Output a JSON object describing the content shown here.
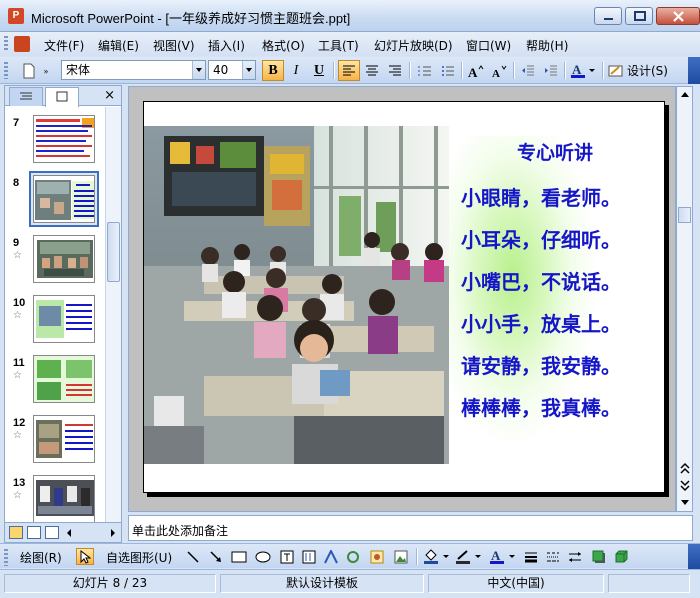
{
  "window": {
    "title": "Microsoft PowerPoint - [一年级养成好习惯主题班会.ppt]",
    "app_icon_letter": "P"
  },
  "menu": {
    "items": [
      "文件(F)",
      "编辑(E)",
      "视图(V)",
      "插入(I)",
      "格式(O)",
      "工具(T)",
      "幻灯片放映(D)",
      "窗口(W)",
      "帮助(H)"
    ]
  },
  "toolbar": {
    "font_name": "宋体",
    "font_size": "40",
    "bold_label": "B",
    "italic_label": "I",
    "underline_label": "U",
    "design_label": "设计(S)"
  },
  "slides_pane": {
    "thumbnails": [
      {
        "number": "7",
        "has_animation": false
      },
      {
        "number": "8",
        "has_animation": false,
        "selected": true
      },
      {
        "number": "9",
        "has_animation": true
      },
      {
        "number": "10",
        "has_animation": true
      },
      {
        "number": "11",
        "has_animation": true
      },
      {
        "number": "12",
        "has_animation": true
      },
      {
        "number": "13",
        "has_animation": true
      }
    ],
    "close_glyph": "×",
    "star_glyph": "☆"
  },
  "slide": {
    "heading": "专心听讲",
    "lines": [
      "小眼睛，看老师。",
      "小耳朵，仔细听。",
      "小嘴巴，不说话。",
      "小小手，放桌上。",
      "请安静，我安静。",
      "棒棒棒，我真棒。"
    ],
    "text_color": "#1616c9"
  },
  "notes": {
    "placeholder": "单击此处添加备注"
  },
  "drawing_toolbar": {
    "draw_label": "绘图(R)",
    "autoshapes_label": "自选图形(U)"
  },
  "status": {
    "slide_indicator": "幻灯片 8 / 23",
    "design_template": "默认设计模板",
    "language": "中文(中国)"
  }
}
